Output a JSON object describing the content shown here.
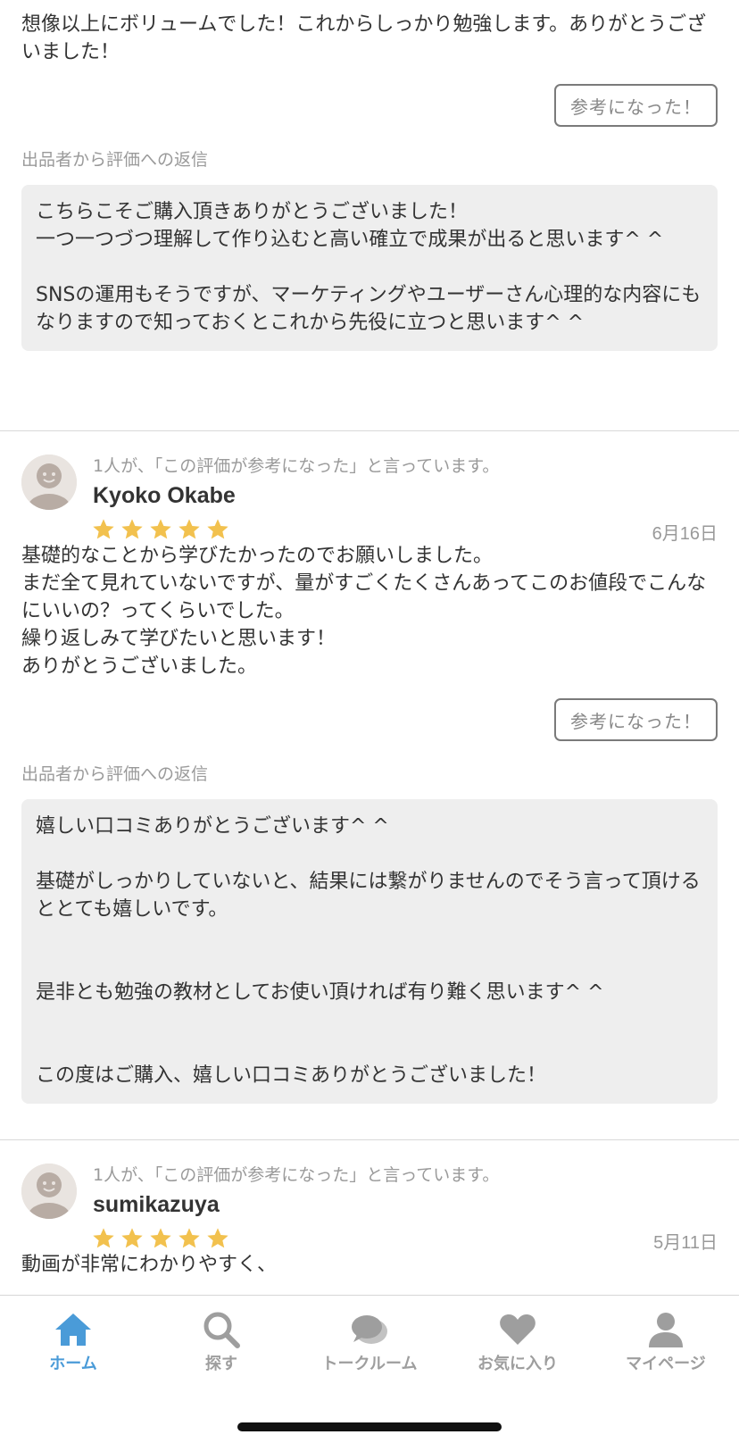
{
  "colors": {
    "accent": "#4a9bd8",
    "star": "#f2c14e",
    "reply_bg": "#eeeeee",
    "muted": "#9a9a9a"
  },
  "review0": {
    "text": "想像以上にボリュームでした！これからしっかり勉強します。ありがとうございました！",
    "helpful_button": "参考になった！",
    "reply_label": "出品者から評価への返信",
    "reply_text": "こちらこそご購入頂きありがとうございました！\n一つ一つづつ理解して作り込むと高い確立で成果が出ると思います^ ^\n\nSNSの運用もそうですが、マーケティングやユーザーさん心理的な内容にもなりますので知っておくとこれから先役に立つと思います^ ^"
  },
  "reviews": [
    {
      "helpful_count": "1人が、「この評価が参考になった」と言っています。",
      "user": "Kyoko Okabe",
      "rating": 5,
      "date": "6月16日",
      "text": "基礎的なことから学びたかったのでお願いしました。\nまだ全て見れていないですが、量がすごくたくさんあってこのお値段でこんなにいいの？ってくらいでした。\n繰り返しみて学びたいと思います！\nありがとうございました。",
      "helpful_button": "参考になった！",
      "reply_label": "出品者から評価への返信",
      "reply_text": "嬉しい口コミありがとうございます^ ^\n\n基礎がしっかりしていないと、結果には繋がりませんのでそう言って頂けるととても嬉しいです。\n\n\n是非とも勉強の教材としてお使い頂ければ有り難く思います^ ^\n\n\nこの度はご購入、嬉しい口コミありがとうございました！"
    },
    {
      "helpful_count": "1人が、「この評価が参考になった」と言っています。",
      "user": "sumikazuya",
      "rating": 5,
      "date": "5月11日",
      "text": "動画が非常にわかりやすく、"
    }
  ],
  "tabbar": {
    "items": [
      {
        "label": "ホーム",
        "icon": "home-icon",
        "active": true
      },
      {
        "label": "探す",
        "icon": "search-icon",
        "active": false
      },
      {
        "label": "トークルーム",
        "icon": "chat-icon",
        "active": false
      },
      {
        "label": "お気に入り",
        "icon": "heart-icon",
        "active": false
      },
      {
        "label": "マイページ",
        "icon": "person-icon",
        "active": false
      }
    ]
  }
}
